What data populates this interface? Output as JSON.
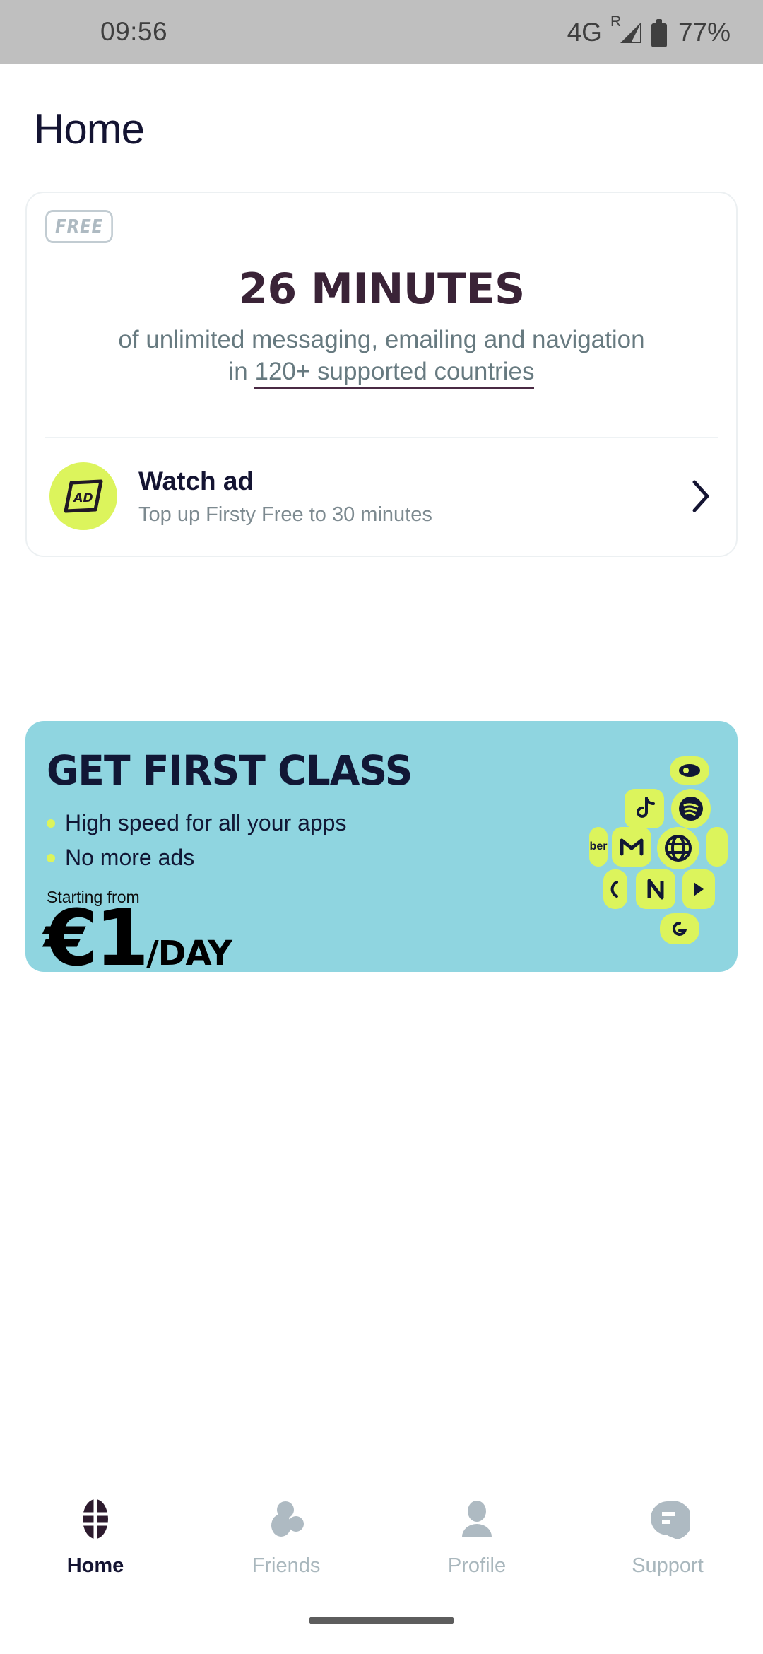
{
  "status_bar": {
    "time": "09:56",
    "network": "4G",
    "roaming_indicator": "R",
    "battery_percent": "77%"
  },
  "header": {
    "title": "Home"
  },
  "free_card": {
    "badge": "FREE",
    "headline": "26 MINUTES",
    "description_line1": "of unlimited messaging, emailing and navigation",
    "description_prefix": "in ",
    "countries_link": "120+ supported countries",
    "watch_ad": {
      "icon_label": "AD",
      "title": "Watch ad",
      "subtitle": "Top up Firsty Free to 30 minutes",
      "chevron": "chevron-right-icon"
    }
  },
  "promo": {
    "title": "GET FIRST CLASS",
    "bullets": [
      "High speed for all your apps",
      "No more ads"
    ],
    "starting_from": "Starting from",
    "price": "€1",
    "price_period": "/DAY",
    "background_color": "#8fd5e0",
    "accent_color": "#dcf45c",
    "app_icons": [
      "video-icon",
      "tiktok-icon",
      "spotify-icon",
      "messenger-icon",
      "gmail-icon",
      "globe-icon",
      "snapchat-icon",
      "whatsapp-icon",
      "netflix-icon",
      "play-icon",
      "google-icon"
    ]
  },
  "bottom_nav": {
    "items": [
      {
        "label": "Home",
        "icon": "globe-icon",
        "active": true
      },
      {
        "label": "Friends",
        "icon": "people-icon",
        "active": false
      },
      {
        "label": "Profile",
        "icon": "person-icon",
        "active": false
      },
      {
        "label": "Support",
        "icon": "chat-bubble-icon",
        "active": false
      }
    ]
  },
  "colors": {
    "brand_lime": "#dcf45c",
    "brand_teal": "#8fd5e0",
    "text_dark": "#141432",
    "text_muted": "#677a80",
    "plum": "#3a2337"
  }
}
